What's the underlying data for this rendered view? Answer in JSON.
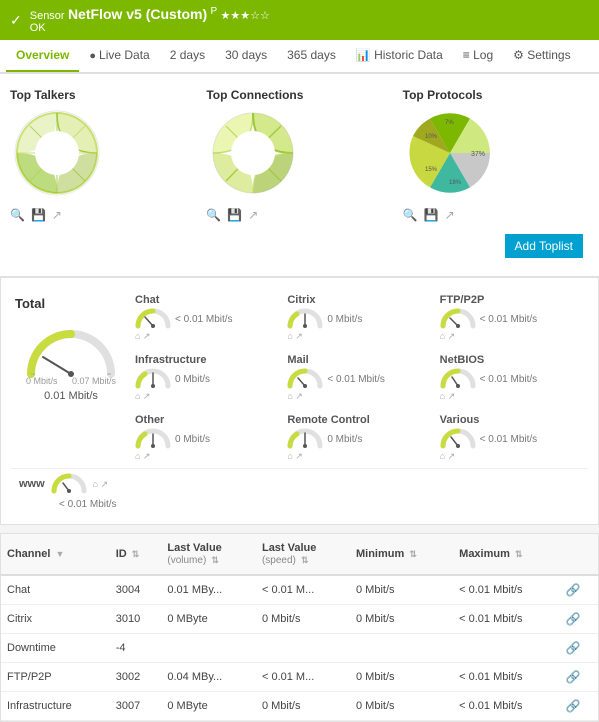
{
  "header": {
    "sensor_prefix": "Sensor",
    "title": "NetFlow v5 (Custom)",
    "superscript": "P",
    "stars": "★★★☆☆",
    "status": "OK"
  },
  "nav": {
    "tabs": [
      {
        "label": "Overview",
        "icon": "",
        "active": true
      },
      {
        "label": "Live Data",
        "icon": "(●)",
        "active": false
      },
      {
        "label": "2 days",
        "icon": "",
        "active": false
      },
      {
        "label": "30 days",
        "icon": "",
        "active": false
      },
      {
        "label": "365 days",
        "icon": "",
        "active": false
      },
      {
        "label": "Historic Data",
        "icon": "📊",
        "active": false
      },
      {
        "label": "Log",
        "icon": "≡",
        "active": false
      },
      {
        "label": "Settings",
        "icon": "⚙",
        "active": false
      }
    ]
  },
  "toplists": {
    "title_1": "Top Talkers",
    "title_2": "Top Connections",
    "title_3": "Top Protocols",
    "add_button": "Add Toplist"
  },
  "gauge_section": {
    "title": "Total",
    "main_value": "0.01 Mbit/s",
    "main_min": "0 Mbit/s",
    "main_max": "0.07 Mbit/s",
    "gauges": [
      {
        "label": "Chat",
        "value": "< 0.01 Mbit/s",
        "row": 1,
        "col": 1
      },
      {
        "label": "Citrix",
        "value": "0 Mbit/s",
        "row": 1,
        "col": 2
      },
      {
        "label": "FTP/P2P",
        "value": "< 0.01 Mbit/s",
        "row": 1,
        "col": 3
      },
      {
        "label": "Infrastructure",
        "value": "0 Mbit/s",
        "row": 2,
        "col": 1
      },
      {
        "label": "Mail",
        "value": "< 0.01 Mbit/s",
        "row": 2,
        "col": 2
      },
      {
        "label": "NetBIOS",
        "value": "< 0.01 Mbit/s",
        "row": 2,
        "col": 3
      },
      {
        "label": "Other",
        "value": "0 Mbit/s",
        "row": 3,
        "col": 1
      },
      {
        "label": "Remote Control",
        "value": "0 Mbit/s",
        "row": 3,
        "col": 2
      },
      {
        "label": "Various",
        "value": "< 0.01 Mbit/s",
        "row": 3,
        "col": 3
      }
    ],
    "www": {
      "label": "www",
      "value": "< 0.01 Mbit/s"
    }
  },
  "table": {
    "columns": [
      {
        "label": "Channel",
        "sort": true
      },
      {
        "label": "ID",
        "sort": true
      },
      {
        "label": "Last Value (volume)",
        "sort": true
      },
      {
        "label": "Last Value (speed)",
        "sort": true
      },
      {
        "label": "Minimum",
        "sort": true
      },
      {
        "label": "Maximum",
        "sort": true
      },
      {
        "label": "",
        "sort": false
      }
    ],
    "rows": [
      {
        "channel": "Chat",
        "id": "3004",
        "last_vol": "0.01 MBy...",
        "last_speed": "< 0.01 M...",
        "minimum": "0 Mbit/s",
        "maximum": "< 0.01 Mbit/s"
      },
      {
        "channel": "Citrix",
        "id": "3010",
        "last_vol": "0 MByte",
        "last_speed": "0 Mbit/s",
        "minimum": "0 Mbit/s",
        "maximum": "< 0.01 Mbit/s"
      },
      {
        "channel": "Downtime",
        "id": "-4",
        "last_vol": "",
        "last_speed": "",
        "minimum": "",
        "maximum": ""
      },
      {
        "channel": "FTP/P2P",
        "id": "3002",
        "last_vol": "0.04 MBy...",
        "last_speed": "< 0.01 M...",
        "minimum": "0 Mbit/s",
        "maximum": "< 0.01 Mbit/s"
      },
      {
        "channel": "Infrastructure",
        "id": "3007",
        "last_vol": "0 MByte",
        "last_speed": "0 Mbit/s",
        "minimum": "0 Mbit/s",
        "maximum": "< 0.01 Mbit/s"
      }
    ]
  }
}
